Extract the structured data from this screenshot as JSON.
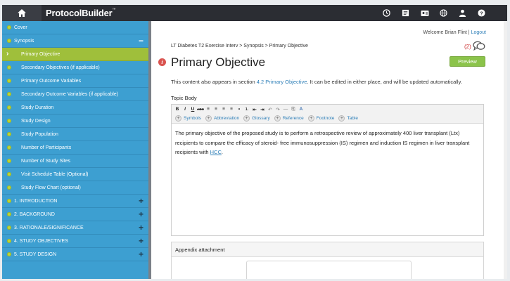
{
  "app": {
    "brand": "ProtocolBuilder",
    "brand_mark": "™"
  },
  "topbar": {
    "icons": [
      "home-icon",
      "clock-icon",
      "document-icon",
      "id-card-icon",
      "globe-icon",
      "user-icon",
      "help-icon"
    ]
  },
  "header": {
    "welcome": "Welcome",
    "user_name": "Brian Flint",
    "separator": "|",
    "logout": "Logout"
  },
  "sidebar": {
    "items": [
      {
        "label": "Cover",
        "kind": "section"
      },
      {
        "label": "Synopsis",
        "kind": "section",
        "toggle": "−"
      },
      {
        "label": "Primary Objective",
        "kind": "active"
      },
      {
        "label": "Secondary Objectives (if applicable)",
        "kind": "sub"
      },
      {
        "label": "Primary Outcome Variables",
        "kind": "sub"
      },
      {
        "label": "Secondary Outcome Variables (if applicable)",
        "kind": "sub"
      },
      {
        "label": "Study Duration",
        "kind": "sub"
      },
      {
        "label": "Study Design",
        "kind": "sub"
      },
      {
        "label": "Study Population",
        "kind": "sub"
      },
      {
        "label": "Number of Participants",
        "kind": "sub"
      },
      {
        "label": "Number of Study Sites",
        "kind": "sub"
      },
      {
        "label": "Visit Schedule Table (Optional)",
        "kind": "sub"
      },
      {
        "label": "Study Flow Chart (optional)",
        "kind": "sub"
      },
      {
        "label": "1. INTRODUCTION",
        "kind": "section",
        "toggle": "+"
      },
      {
        "label": "2. BACKGROUND",
        "kind": "section",
        "toggle": "+"
      },
      {
        "label": "3. RATIONALE/SIGNIFICANCE",
        "kind": "section",
        "toggle": "+"
      },
      {
        "label": "4. STUDY OBJECTIVES",
        "kind": "section",
        "toggle": "+"
      },
      {
        "label": "5. STUDY DESIGN",
        "kind": "section",
        "toggle": "+"
      }
    ]
  },
  "main": {
    "breadcrumb": "LT Diabetes T2 Exercise Interv > Synopsis > Primary Objective",
    "comment_count": "(2)",
    "info_mark": "i",
    "title": "Primary Objective",
    "preview_label": "Preview",
    "appears_prefix": "This content also appears in section ",
    "appears_link": "4.2 Primary Objective",
    "appears_suffix": ". It can be edited in either place, and will be updated automatically.",
    "topic_label": "Topic Body",
    "toolbar_row1": [
      "B",
      "I",
      "U",
      "ABC",
      "≡",
      "≡",
      "≡",
      "≡",
      "•",
      "1.",
      "⇤",
      "⇥",
      "↶",
      "↷",
      "—",
      "⎘",
      "A"
    ],
    "toolbar_row2": [
      {
        "plus": "+",
        "label": "Symbols"
      },
      {
        "plus": "+",
        "label": "Abbreviation"
      },
      {
        "plus": "+",
        "label": "Glossary"
      },
      {
        "plus": "+",
        "label": "Reference"
      },
      {
        "plus": "+",
        "label": "Footnote"
      },
      {
        "plus": "+",
        "label": "Table"
      }
    ],
    "body_text": "The primary objective of the proposed study is to perform a retrospective review of approximately 400 liver transplant (Ltx) recipients to compare the efficacy of steroid- free immunosuppression (IS) regimen and induction IS regimen in liver transplant recipients with ",
    "body_term": "HCC",
    "body_end": ".",
    "appendix_title": "Appendix attachment"
  },
  "colors": {
    "topbar": "#2b2d33",
    "sidebar": "#3d9fd1",
    "active": "#9fbf3b",
    "accent_green": "#8bc34a",
    "link": "#2e7fb8"
  }
}
